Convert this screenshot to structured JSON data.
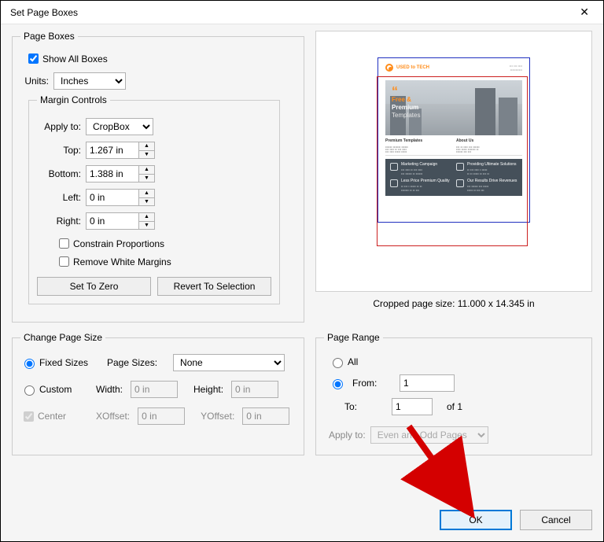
{
  "window": {
    "title": "Set Page Boxes"
  },
  "pageBoxes": {
    "legend": "Page Boxes",
    "showAll": "Show All Boxes",
    "unitsLabel": "Units:",
    "unitsValue": "Inches"
  },
  "marginControls": {
    "legend": "Margin Controls",
    "applyToLabel": "Apply to:",
    "applyToValue": "CropBox",
    "top": {
      "label": "Top:",
      "value": "1.267 in"
    },
    "bottom": {
      "label": "Bottom:",
      "value": "1.388 in"
    },
    "left": {
      "label": "Left:",
      "value": "0 in"
    },
    "right": {
      "label": "Right:",
      "value": "0 in"
    },
    "constrain": "Constrain Proportions",
    "removeWhite": "Remove White Margins",
    "setZero": "Set To Zero",
    "revert": "Revert To Selection"
  },
  "preview": {
    "caption": "Cropped page size: 11.000 x 14.345 in",
    "brand": "USED to TECH",
    "hero": {
      "free": "Free &",
      "premium": "Premium",
      "templates": "Templates"
    },
    "cols": {
      "left": "Premium Templates",
      "right": "About Us"
    },
    "dark": {
      "a": "Marketing Campaign",
      "b": "Providing Ultimate Solutions",
      "c": "Less Price Premium Quality",
      "d": "Our Results Drive Revenues"
    }
  },
  "changeSize": {
    "legend": "Change Page Size",
    "fixed": "Fixed Sizes",
    "custom": "Custom",
    "pageSizesLabel": "Page Sizes:",
    "pageSizesValue": "None",
    "widthLabel": "Width:",
    "widthValue": "0 in",
    "heightLabel": "Height:",
    "heightValue": "0 in",
    "center": "Center",
    "xoffLabel": "XOffset:",
    "xoffValue": "0 in",
    "yoffLabel": "YOffset:",
    "yoffValue": "0 in"
  },
  "pageRange": {
    "legend": "Page Range",
    "all": "All",
    "fromLabel": "From:",
    "fromValue": "1",
    "toLabel": "To:",
    "toValue": "1",
    "ofText": "of 1",
    "applyLabel": "Apply to:",
    "applyValue": "Even and Odd Pages"
  },
  "footer": {
    "ok": "OK",
    "cancel": "Cancel"
  }
}
